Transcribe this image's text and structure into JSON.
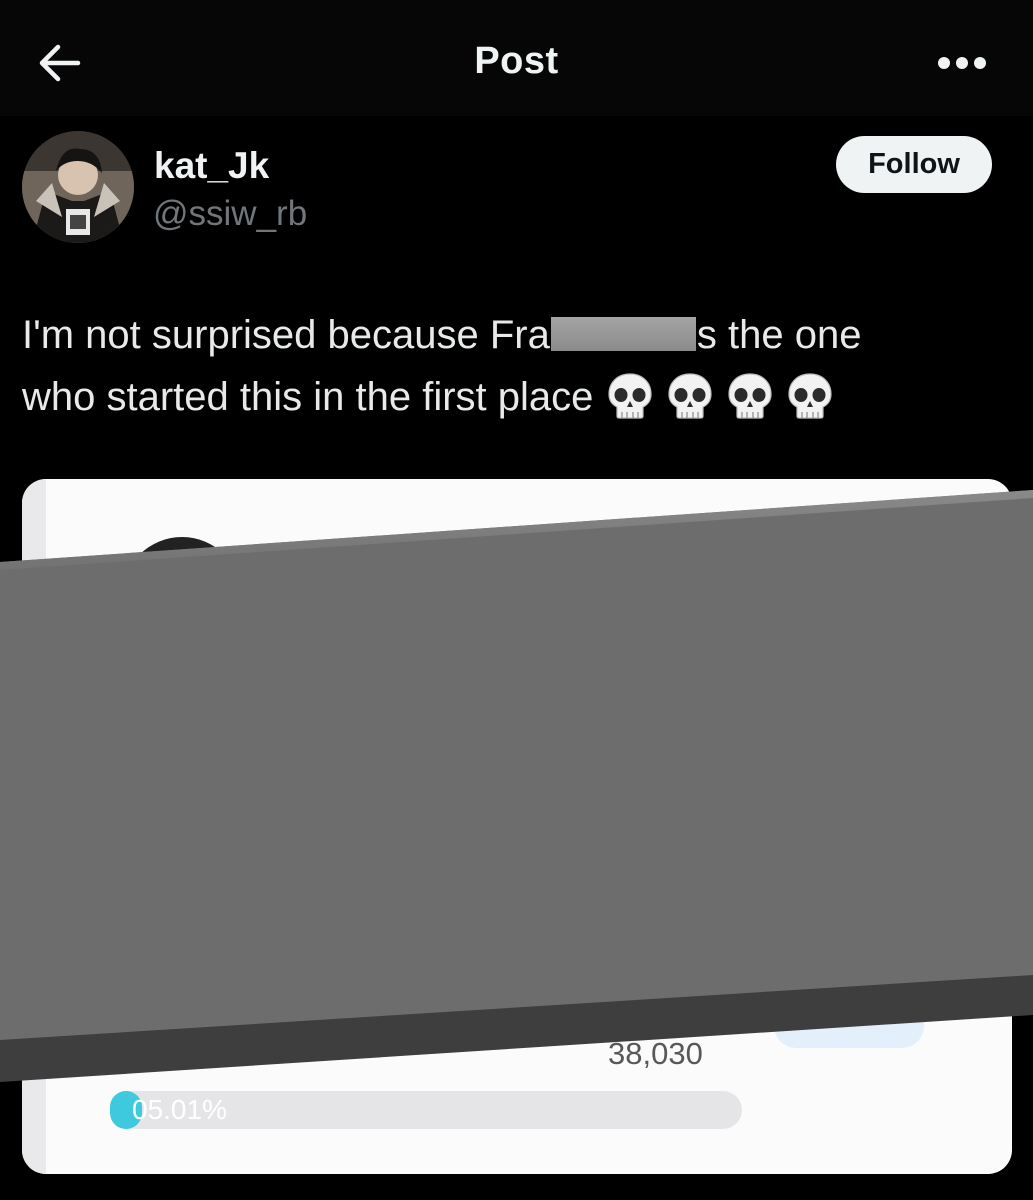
{
  "header": {
    "title": "Post",
    "back_icon": "arrow-left-icon",
    "more_icon": "more-horizontal-icon"
  },
  "author": {
    "name": "kat_Jk",
    "handle": "@ssiw_rb",
    "avatar_icon": "profile-photo",
    "follow_label": "Follow"
  },
  "post": {
    "line1_before": "I'm not surprised because Fra",
    "line1_after": "s the one",
    "line2_text": "who started this in the first place",
    "emoji_icon": "skull-emoji-icon",
    "emoji_count": 4
  },
  "media": {
    "vote_count": "38,030",
    "progress_label": "05.01%",
    "progress_value": 0.0501,
    "progress_color": "#3ec9df"
  },
  "colors": {
    "background": "#000000",
    "text": "#e7e9ea",
    "secondary_text": "#71767b",
    "follow_bg": "#eff3f4",
    "redaction_gray": "#6e6e6e"
  }
}
